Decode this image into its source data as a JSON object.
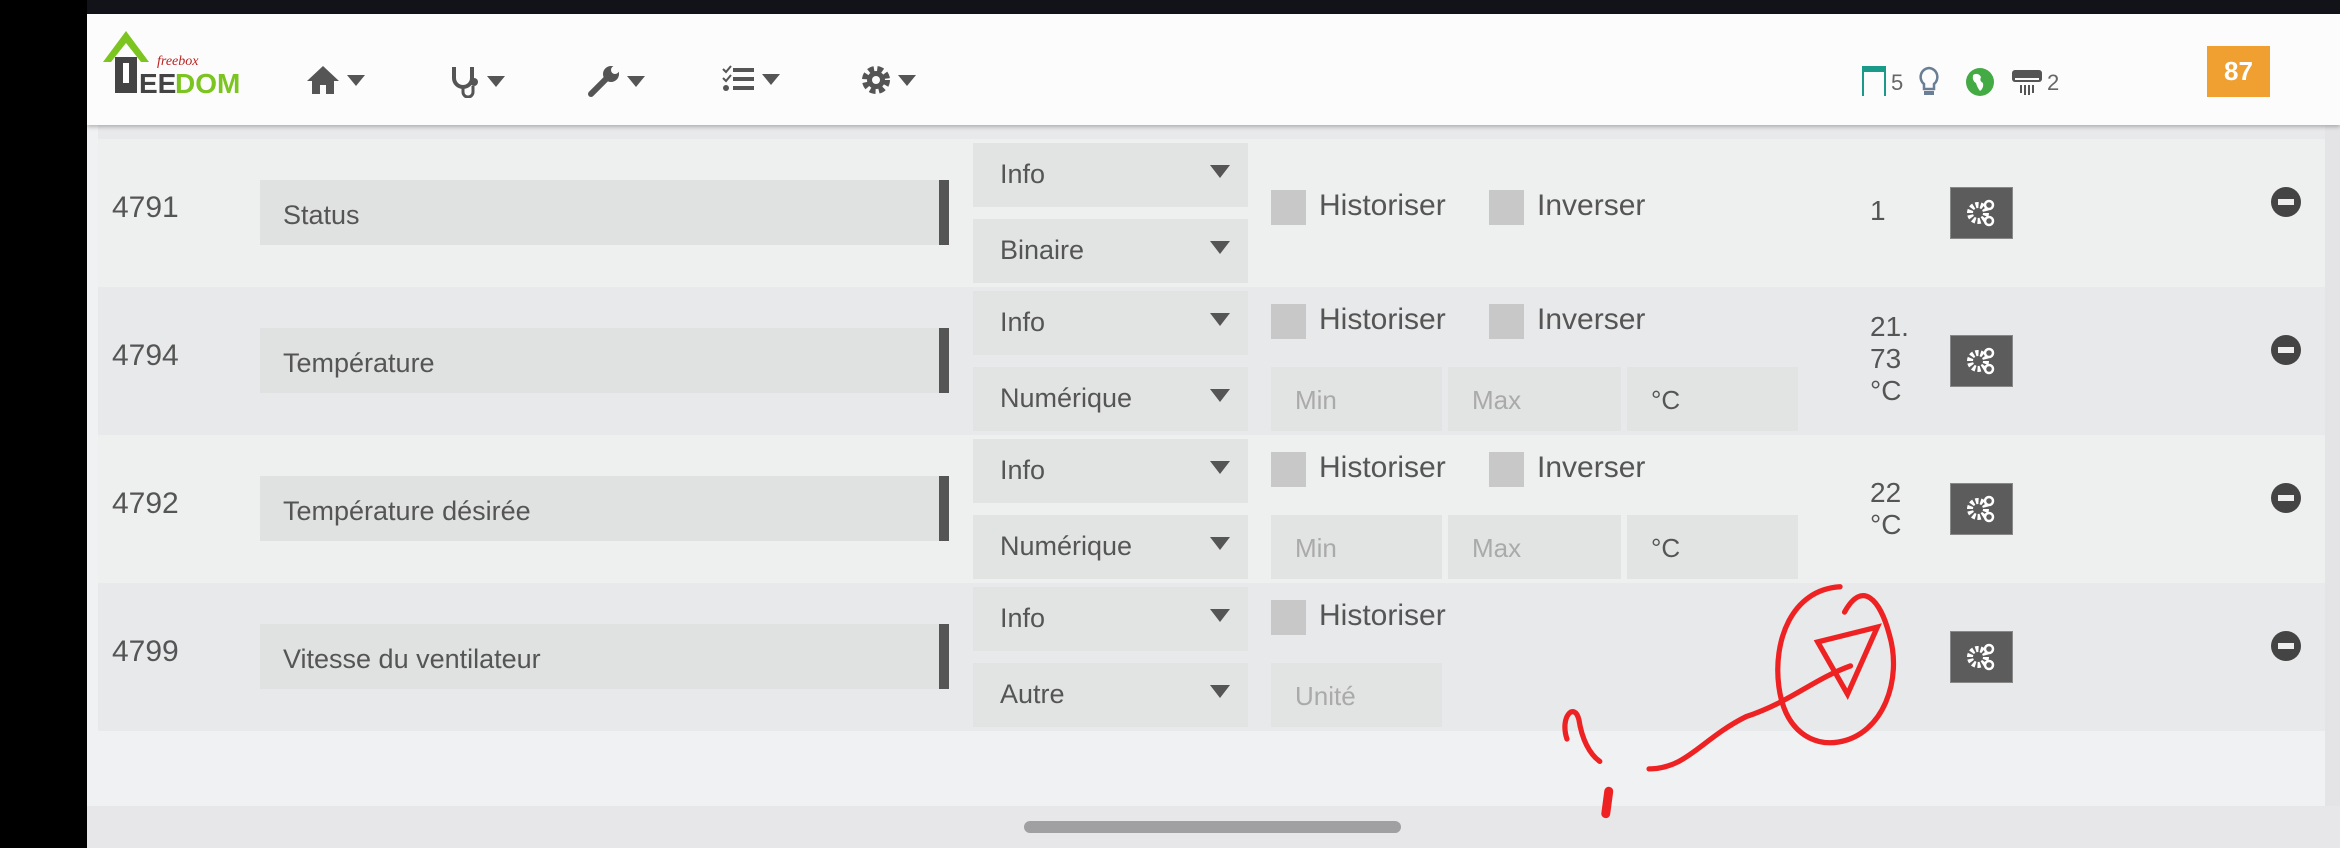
{
  "nav": {
    "logo_text": "JEEDOM",
    "logo_sub": "freebox",
    "menus": [
      {
        "icon": "home-icon"
      },
      {
        "icon": "stethoscope-icon"
      },
      {
        "icon": "wrench-icon"
      },
      {
        "icon": "tasks-icon"
      },
      {
        "icon": "gear-icon"
      }
    ],
    "status": {
      "shutters_count": "5",
      "ac_count": "2",
      "badge": "87"
    }
  },
  "rows": [
    {
      "id": "4791",
      "name": "Status",
      "type": "Info",
      "subtype": "Binaire",
      "historiser": "Historiser",
      "inverser": "Inverser",
      "value": [
        "1"
      ]
    },
    {
      "id": "4794",
      "name": "Température",
      "type": "Info",
      "subtype": "Numérique",
      "historiser": "Historiser",
      "inverser": "Inverser",
      "min": "Min",
      "max": "Max",
      "unit": "°C",
      "value": [
        "21.",
        "73",
        "°C"
      ]
    },
    {
      "id": "4792",
      "name": "Température désirée",
      "type": "Info",
      "subtype": "Numérique",
      "historiser": "Historiser",
      "inverser": "Inverser",
      "min": "Min",
      "max": "Max",
      "unit": "°C",
      "value": [
        "22",
        "°C"
      ]
    },
    {
      "id": "4799",
      "name": "Vitesse du ventilateur",
      "type": "Info",
      "subtype": "Autre",
      "historiser": "Historiser",
      "unit_placeholder": "Unité",
      "value": []
    }
  ],
  "annotation": {
    "color": "#ee2222",
    "text": "?"
  }
}
